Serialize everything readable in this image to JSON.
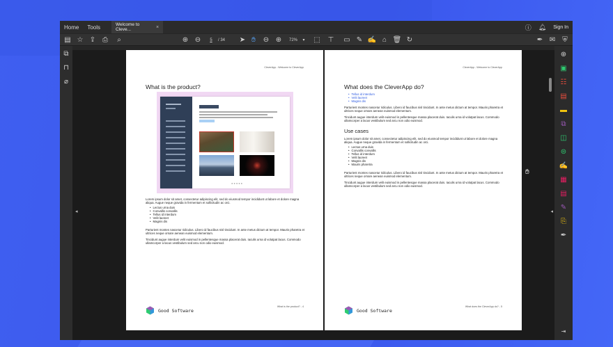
{
  "menubar": {
    "items": [
      "Home",
      "Tools"
    ],
    "tab_label": "Welcome to Cleve...",
    "tab_close": "×",
    "help_icon": "help-icon",
    "bell_icon": "bell-icon",
    "sign_in": "Sign In"
  },
  "toolbar": {
    "current_page": "5",
    "page_total": "/ 34",
    "zoom": "72%",
    "zoom_caret": "▾"
  },
  "left_page": {
    "header": "CleverApp - Welcome to CleverApp",
    "title": "What is the product?",
    "para1": "Lorem ipsum dolor sit amet, consectetur adipiscing elit, sed do eiusmod tempor incididunt ut labore et dolore magna aliqua. Augue neque gravida in fermentum et sollicitudin ac orci.",
    "list": [
      "Lectus urna duis",
      "Convallis convallis",
      "Tellus id interdum",
      "Velit laoreet",
      "Magnis dis"
    ],
    "para2": "Parturient montes nascetur ridiculus. Libero id faucibus nisl tincidunt. In ante metus dictum at tempor. Mauris pharetra et ultrices neque ornare aenean euismod elementum.",
    "para3": "Tincidunt augue interdum velit euismod in pellentesque massa placerat duis. Iaculis urna id volutpat lacus. Commodo ullamcorper a lacus vestibulum sed arcu non odio euismod.",
    "footer": "What is the product? - 4",
    "logo": "Good Software"
  },
  "right_page": {
    "header": "CleverApp - Welcome to CleverApp",
    "title": "What does the CleverApp do?",
    "links": [
      "Tellus id interdum",
      "Velit laoreet",
      "Magnis dis"
    ],
    "para1": "Parturient montes nascetur ridiculus. Libero id faucibus nisl tincidunt. In ante metus dictum at tempor. Mauris pharetra et ultrices neque ornare aenean euismod elementum.",
    "para2": "Tincidunt augue interdum velit euismod in pellentesque massa placerat duis. Iaculis urna id volutpat lacus. Commodo ullamcorper a lacus vestibulum sed arcu non odio euismod.",
    "subtitle": "Use cases",
    "para3": "Lorem ipsum dolor sit amet, consectetur adipiscing elit, sed do eiusmod tempor incididunt ut labore et dolore magna aliqua. Augue neque gravida in fermentum et sollicitudin ac orci.",
    "list": [
      "Lectus urna duis",
      "Convallis convallis",
      "Tellus id interdum",
      "Velit laoreet",
      "Magnis dis",
      "Mauris pharetra"
    ],
    "para4": "Parturient montes nascetur ridiculus. Libero id faucibus nisl tincidunt. In ante metus dictum at tempor. Mauris pharetra et ultrices neque ornare aenean euismod elementum.",
    "para5": "Tincidunt augue interdum velit euismod in pellentesque massa placerat duis. Iaculis urna id volutpat lacus. Commodo ullamcorper a lacus vestibulum sed arcu non odio euismod.",
    "footer": "What does the CleverApp do? - 5",
    "logo": "Good Software"
  },
  "colors": {
    "background": "#3f5ff0",
    "app_chrome": "#2b2b2b",
    "link_blue": "#2e5be0",
    "selection_blue": "#5aa8ff"
  }
}
